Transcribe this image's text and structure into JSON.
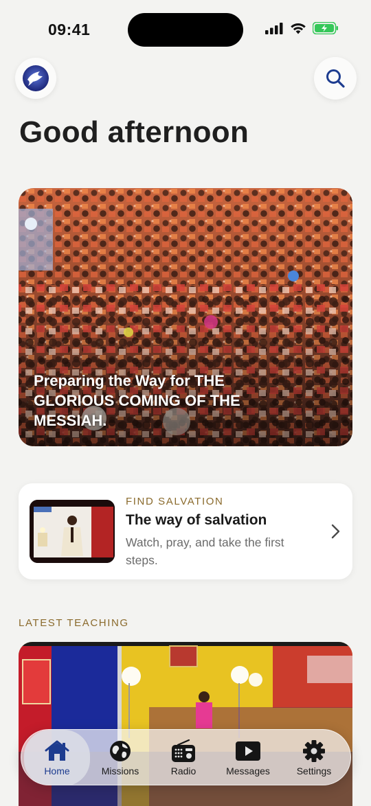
{
  "status_bar": {
    "time": "09:41"
  },
  "header": {
    "logo_icon": "dove-logo-icon",
    "search_icon": "search-icon",
    "greeting": "Good afternoon"
  },
  "hero": {
    "title": "Preparing the Way for THE GLORIOUS COMING OF THE MESSIAH."
  },
  "salvation_card": {
    "kicker": "FIND SALVATION",
    "title": "The way of salvation",
    "description": "Watch, pray, and take the first steps.",
    "chevron_icon": "chevron-right-icon"
  },
  "latest_teaching": {
    "label": "LATEST TEACHING"
  },
  "tab_bar": {
    "active": "Home",
    "accent_color": "#1d3c8f",
    "items": [
      {
        "label": "Home",
        "icon": "home-icon"
      },
      {
        "label": "Missions",
        "icon": "globe-icon"
      },
      {
        "label": "Radio",
        "icon": "radio-icon"
      },
      {
        "label": "Messages",
        "icon": "play-icon"
      },
      {
        "label": "Settings",
        "icon": "gear-icon"
      }
    ]
  }
}
